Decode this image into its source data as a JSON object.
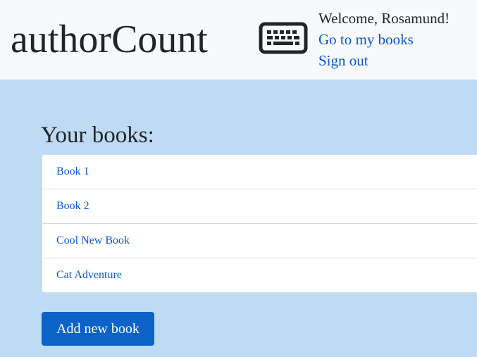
{
  "header": {
    "brand": "authorCount",
    "brand_icon": "keyboard-icon",
    "welcome": "Welcome, Rosamund!",
    "my_books_link": "Go to my books",
    "sign_out_link": "Sign out"
  },
  "main": {
    "title": "Your books:",
    "books": [
      {
        "label": "Book 1"
      },
      {
        "label": "Book 2"
      },
      {
        "label": "Cool New Book"
      },
      {
        "label": "Cat Adventure"
      }
    ],
    "add_button": "Add new book"
  },
  "colors": {
    "background": "#bedbf3",
    "header": "#f8f9fa",
    "link": "#0a58ca",
    "button": "#0b63c8"
  }
}
